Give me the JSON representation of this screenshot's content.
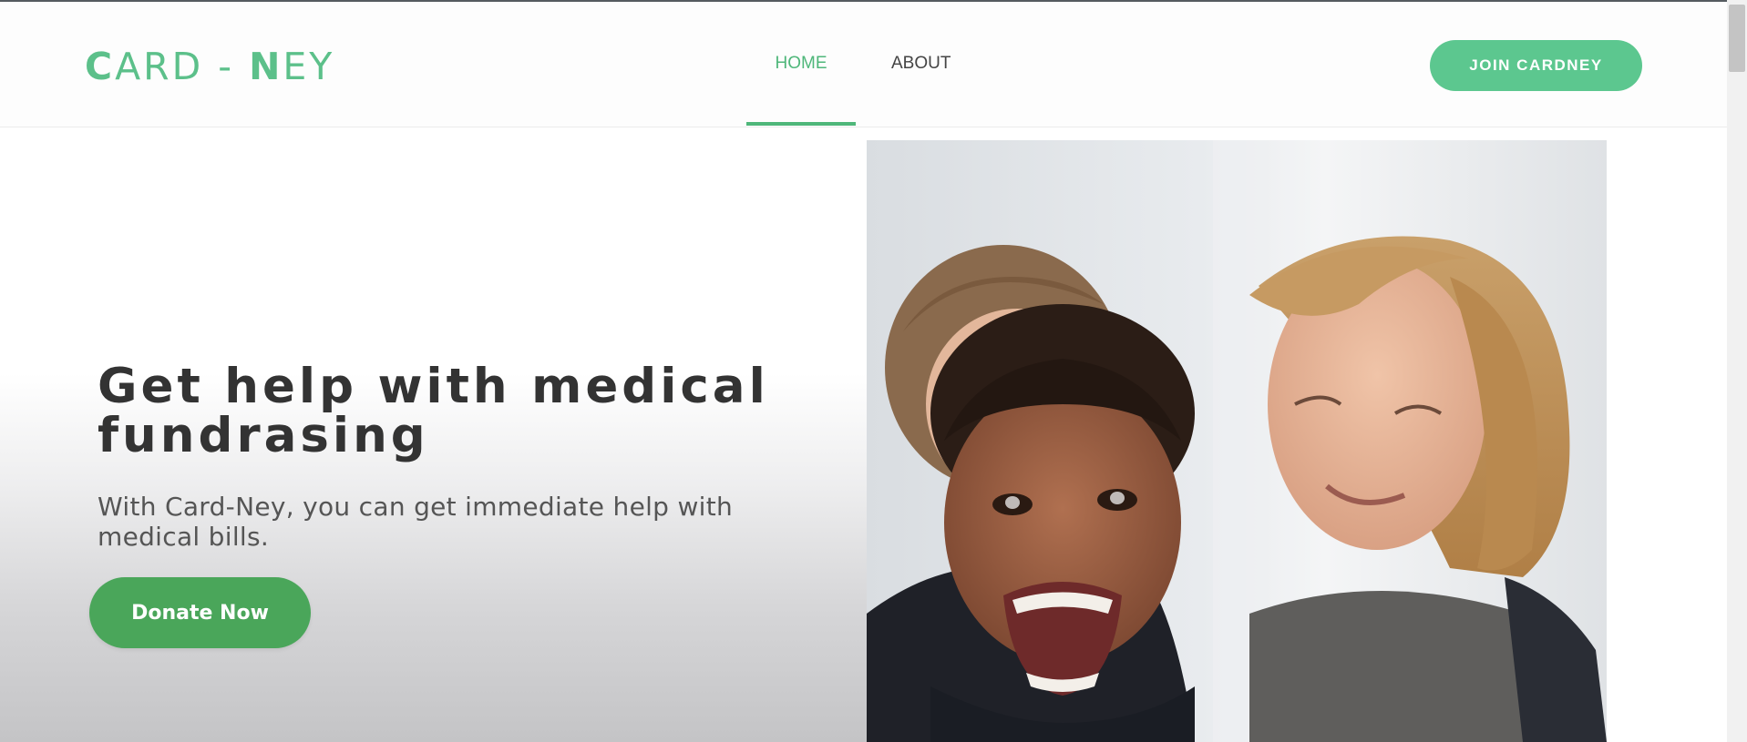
{
  "header": {
    "logo_text": "CARD-NEY",
    "nav": [
      {
        "label": "HOME",
        "active": true
      },
      {
        "label": "ABOUT",
        "active": false
      }
    ],
    "cta_label": "JOIN CARDNEY"
  },
  "hero": {
    "headline_line1": "Get help with medical",
    "headline_line2": "fundrasing",
    "subtext_line1": "With Card-Ney, you can get immediate help with",
    "subtext_line2": "medical bills.",
    "donate_label": "Donate Now",
    "image_alt": "Smiling woman holding a laughing child"
  },
  "colors": {
    "brand_green": "#5cc08a",
    "nav_active": "#4fb77a",
    "donate_button": "#4aa65a",
    "headline_text": "#333333"
  }
}
